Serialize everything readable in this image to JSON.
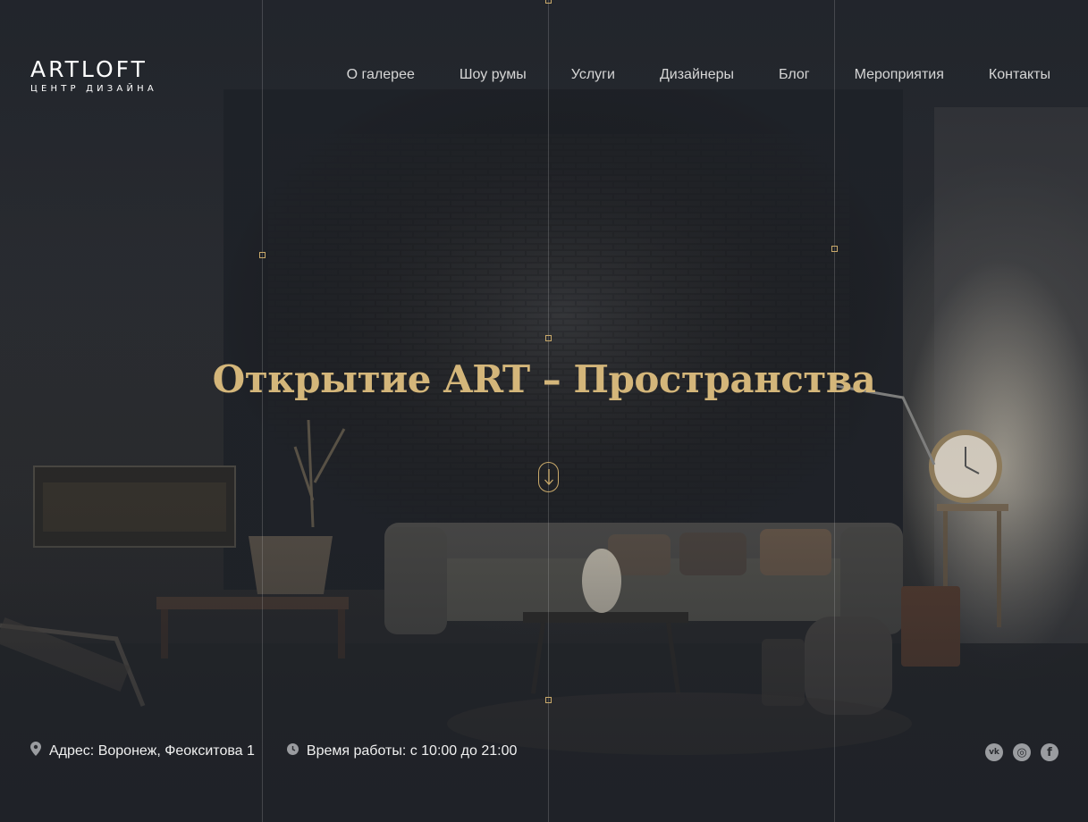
{
  "brand": {
    "name": "ARTLOFT",
    "tagline": "ЦЕНТР ДИЗАЙНА"
  },
  "nav": {
    "items": [
      {
        "label": "О галерее"
      },
      {
        "label": "Шоу румы"
      },
      {
        "label": "Услуги"
      },
      {
        "label": "Дизайнеры"
      },
      {
        "label": "Блог"
      },
      {
        "label": "Мероприятия"
      },
      {
        "label": "Контакты"
      }
    ]
  },
  "hero": {
    "title": "Открытие ART – Пространства",
    "scroll_icon": "arrow-down-icon"
  },
  "footer": {
    "address": "Адрес: Воронеж, Феокситова 1",
    "hours": "Время работы: с 10:00 до 21:00",
    "address_icon": "location-pin-icon",
    "hours_icon": "clock-icon",
    "social": [
      {
        "icon": "vk-icon",
        "glyph": "vk"
      },
      {
        "icon": "instagram-icon",
        "glyph": "◎"
      },
      {
        "icon": "facebook-icon",
        "glyph": "f"
      }
    ]
  },
  "colors": {
    "accent_gold": "#d4b67a",
    "marker_gold": "#c9a96a",
    "background": "#1e2127",
    "social_icon_bg": "#9a9ca0"
  }
}
